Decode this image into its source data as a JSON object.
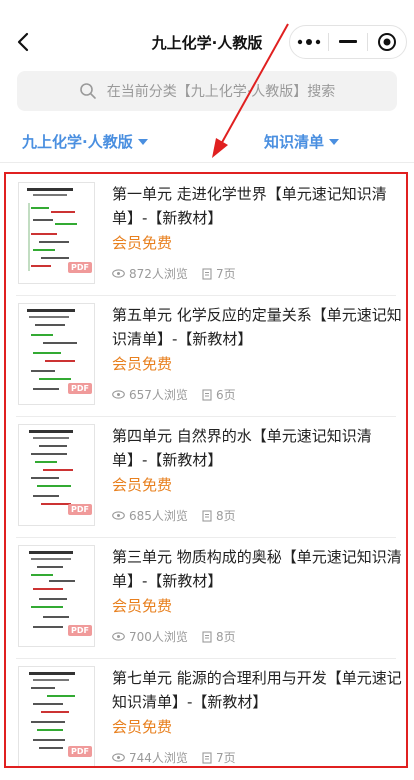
{
  "header": {
    "title": "九上化学·人教版",
    "back_icon": "chevron-left-icon",
    "more_icon": "more-dots-icon",
    "minimize_icon": "minimize-icon",
    "close_icon": "target-circle-icon"
  },
  "search": {
    "placeholder": "在当前分类【九上化学·人教版】搜索",
    "icon": "search-icon"
  },
  "filters": {
    "category": "九上化学·人教版",
    "type": "知识清单",
    "accent_color": "#4a8fe0"
  },
  "colors": {
    "tag": "#e8801f",
    "highlight_border": "#e02020",
    "arrow": "#e02020"
  },
  "items": [
    {
      "title": "第一单元 走进化学世界【单元速记知识清单】-【新教材】",
      "tag": "会员免费",
      "views": "872人浏览",
      "pages": "7页",
      "badge": "PDF"
    },
    {
      "title": "第五单元 化学反应的定量关系【单元速记知识清单】-【新教材】",
      "tag": "会员免费",
      "views": "657人浏览",
      "pages": "6页",
      "badge": "PDF"
    },
    {
      "title": "第四单元 自然界的水【单元速记知识清单】-【新教材】",
      "tag": "会员免费",
      "views": "685人浏览",
      "pages": "8页",
      "badge": "PDF"
    },
    {
      "title": "第三单元 物质构成的奥秘【单元速记知识清单】-【新教材】",
      "tag": "会员免费",
      "views": "700人浏览",
      "pages": "8页",
      "badge": "PDF"
    },
    {
      "title": "第七单元 能源的合理利用与开发【单元速记知识清单】-【新教材】",
      "tag": "会员免费",
      "views": "744人浏览",
      "pages": "7页",
      "badge": "PDF"
    }
  ]
}
